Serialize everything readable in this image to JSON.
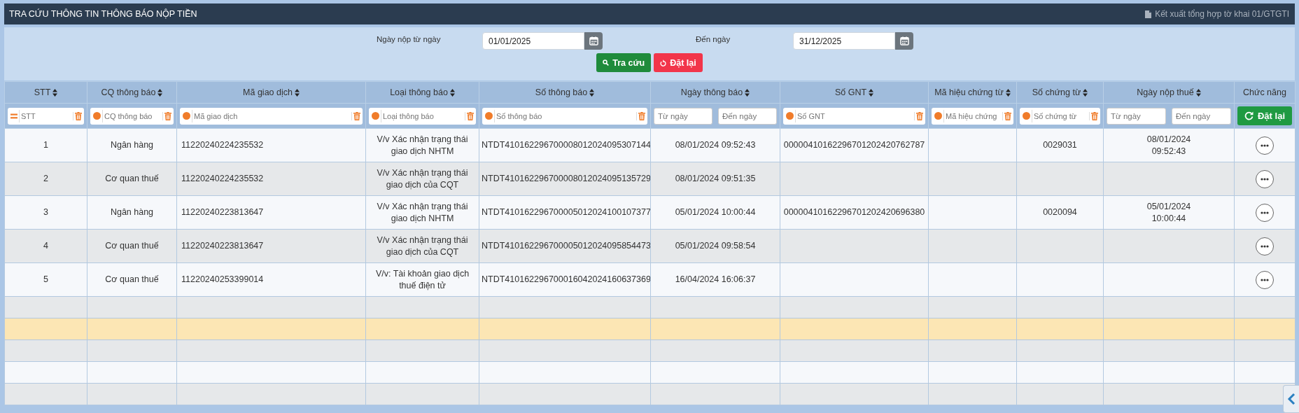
{
  "title_bar": {
    "title": "TRA CỨU THÔNG TIN THÔNG BÁO NỘP TIỀN",
    "export_link": "Kết xuất tổng hợp tờ khai 01/GTGTI"
  },
  "search_form": {
    "from_label": "Ngày nộp từ ngày",
    "from_value": "01/01/2025",
    "to_label": "Đến ngày",
    "to_value": "31/12/2025",
    "search_button": "Tra cứu",
    "reset_button": "Đặt lại"
  },
  "table": {
    "columns": [
      {
        "label": "STT",
        "sortable": true,
        "filter": {
          "kind": "text",
          "exact": true,
          "placeholder": "STT"
        }
      },
      {
        "label": "CQ thông báo",
        "sortable": true,
        "filter": {
          "kind": "text",
          "exact": false,
          "placeholder": "CQ thông báo"
        }
      },
      {
        "label": "Mã giao dịch",
        "sortable": true,
        "filter": {
          "kind": "text",
          "exact": false,
          "placeholder": "Mã giao dịch"
        }
      },
      {
        "label": "Loại thông báo",
        "sortable": true,
        "filter": {
          "kind": "text",
          "exact": false,
          "placeholder": "Loại thông báo"
        }
      },
      {
        "label": "Số thông báo",
        "sortable": true,
        "filter": {
          "kind": "text",
          "exact": false,
          "placeholder": "Số thông báo"
        }
      },
      {
        "label": "Ngày thông báo",
        "sortable": true,
        "filter": {
          "kind": "range",
          "from_placeholder": "Từ ngày",
          "to_placeholder": "Đến ngày"
        }
      },
      {
        "label": "Số GNT",
        "sortable": true,
        "filter": {
          "kind": "text",
          "exact": false,
          "placeholder": "Số GNT"
        }
      },
      {
        "label": "Mã hiệu chứng từ",
        "sortable": true,
        "filter": {
          "kind": "text",
          "exact": false,
          "placeholder": "Mã hiệu chứng"
        }
      },
      {
        "label": "Số chứng từ",
        "sortable": true,
        "filter": {
          "kind": "text",
          "exact": false,
          "placeholder": "Số chứng từ"
        }
      },
      {
        "label": "Ngày nộp thuế",
        "sortable": true,
        "filter": {
          "kind": "range",
          "from_placeholder": "Từ ngày",
          "to_placeholder": "Đến ngày"
        }
      },
      {
        "label": "Chức năng",
        "sortable": false,
        "filter": {
          "kind": "button",
          "label": "Đặt lại"
        }
      }
    ],
    "rows": [
      {
        "cells": [
          "1",
          "Ngân hàng",
          "11220240224235532",
          "V/v Xác nhận trạng thái giao dịch NHTM",
          "NTDT410162296700008012024095307144",
          "08/01/2024 09:52:43",
          "00000410162296701202420762787",
          null,
          "0029031",
          "08/01/2024\n09:52:43"
        ]
      },
      {
        "cells": [
          "2",
          "Cơ quan thuế",
          "11220240224235532",
          "V/v Xác nhận trạng thái giao dịch của CQT",
          "NTDT410162296700008012024095135729",
          "08/01/2024 09:51:35",
          null,
          null,
          null,
          null
        ]
      },
      {
        "cells": [
          "3",
          "Ngân hàng",
          "11220240223813647",
          "V/v Xác nhận trạng thái giao dịch NHTM",
          "NTDT410162296700005012024100107377",
          "05/01/2024 10:00:44",
          "00000410162296701202420696380",
          null,
          "0020094",
          "05/01/2024\n10:00:44"
        ]
      },
      {
        "cells": [
          "4",
          "Cơ quan thuế",
          "11220240223813647",
          "V/v Xác nhận trạng thái giao dịch của CQT",
          "NTDT410162296700005012024095854473",
          "05/01/2024 09:58:54",
          null,
          null,
          null,
          null
        ]
      },
      {
        "cells": [
          "5",
          "Cơ quan thuế",
          "11220240253399014",
          "V/v: Tài khoản giao dịch thuế điện tử",
          "NTDT410162296700016042024160637369",
          "16/04/2024 16:06:37",
          null,
          null,
          null,
          null
        ]
      }
    ],
    "empty_rows": [
      {
        "highlighted": false
      },
      {
        "highlighted": true
      },
      {
        "highlighted": false
      },
      {
        "highlighted": false
      },
      {
        "highlighted": false
      }
    ]
  }
}
